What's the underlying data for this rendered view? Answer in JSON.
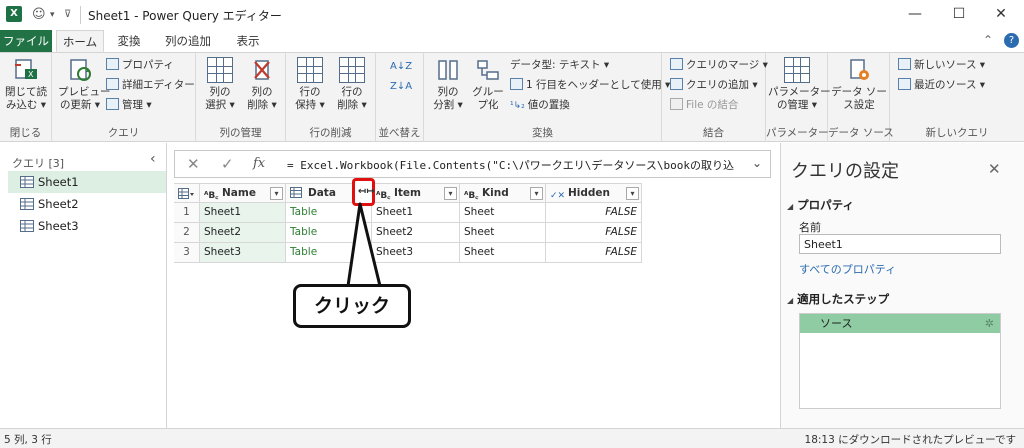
{
  "title_bar": {
    "app_icon": "X",
    "window_title": "Sheet1 - Power Query エディター",
    "minimize": "—",
    "maximize": "☐",
    "close": "✕"
  },
  "tabs": {
    "file": "ファイル",
    "home": "ホーム",
    "transform": "変換",
    "add_column": "列の追加",
    "view": "表示"
  },
  "ribbon": {
    "close_group": {
      "close_load": [
        "閉じて読",
        "み込む ▾"
      ],
      "label": "閉じる"
    },
    "query_group": {
      "refresh_preview": [
        "プレビュー",
        "の更新 ▾"
      ],
      "properties": "プロパティ",
      "advanced_editor": "詳細エディター",
      "manage": "管理 ▾",
      "label": "クエリ"
    },
    "manage_columns_group": {
      "choose_columns": [
        "列の",
        "選択 ▾"
      ],
      "remove_columns": [
        "列の",
        "削除 ▾"
      ],
      "label": "列の管理"
    },
    "reduce_rows_group": {
      "keep_rows": [
        "行の",
        "保持 ▾"
      ],
      "remove_rows": [
        "行の",
        "削除 ▾"
      ],
      "label": "行の削減"
    },
    "sort_group": {
      "label": "並べ替え"
    },
    "transform_group": {
      "split_column": [
        "列の",
        "分割 ▾"
      ],
      "group_by": [
        "グルー",
        "プ化"
      ],
      "data_type": "データ型: テキスト ▾",
      "use_first_row": "1 行目をヘッダーとして使用 ▾",
      "replace_values": "値の置換",
      "label": "変換"
    },
    "combine_group": {
      "merge_queries": "クエリのマージ ▾",
      "append_queries": "クエリの追加 ▾",
      "combine_files": "File の結合",
      "label": "結合"
    },
    "parameters_group": {
      "manage_parameters": [
        "パラメーター",
        "の管理 ▾"
      ],
      "label": "パラメーター"
    },
    "data_sources_group": {
      "data_source_settings": [
        "データ ソー",
        "ス設定"
      ],
      "label": "データ ソース"
    },
    "new_query_group": {
      "new_source": "新しいソース ▾",
      "recent_sources": "最近のソース ▾",
      "label": "新しいクエリ"
    }
  },
  "queries_pane": {
    "header": "クエリ [3]",
    "items": [
      {
        "label": "Sheet1",
        "selected": true
      },
      {
        "label": "Sheet2",
        "selected": false
      },
      {
        "label": "Sheet3",
        "selected": false
      }
    ]
  },
  "formula_bar": {
    "cancel": "✕",
    "commit": "✓",
    "fx": "fx",
    "formula": "= Excel.Workbook(File.Contents(\"C:\\パワークエリ\\データソース\\bookの取り込"
  },
  "grid": {
    "columns": [
      {
        "name": "Name",
        "type": "ABC"
      },
      {
        "name": "Data",
        "type": "table"
      },
      {
        "name": "Item",
        "type": "ABC"
      },
      {
        "name": "Kind",
        "type": "ABC"
      },
      {
        "name": "Hidden",
        "type": "bool"
      }
    ],
    "rows": [
      {
        "num": "1",
        "name": "Sheet1",
        "data": "Table",
        "item": "Sheet1",
        "kind": "Sheet",
        "hidden": "FALSE"
      },
      {
        "num": "2",
        "name": "Sheet2",
        "data": "Table",
        "item": "Sheet2",
        "kind": "Sheet",
        "hidden": "FALSE"
      },
      {
        "num": "3",
        "name": "Sheet3",
        "data": "Table",
        "item": "Sheet3",
        "kind": "Sheet",
        "hidden": "FALSE"
      }
    ]
  },
  "callout": {
    "text": "クリック"
  },
  "settings_pane": {
    "title": "クエリの設定",
    "properties_header": "プロパティ",
    "name_label": "名前",
    "name_value": "Sheet1",
    "all_properties": "すべてのプロパティ",
    "applied_steps_header": "適用したステップ",
    "steps": [
      "ソース"
    ]
  },
  "status_bar": {
    "left": "5 列, 3 行",
    "right": "18:13 にダウンロードされたプレビューです"
  },
  "colors": {
    "excel_green": "#217346",
    "selected_query": "#dcefe2",
    "highlight_red": "#e01010",
    "step_selected": "#8fcca3"
  }
}
